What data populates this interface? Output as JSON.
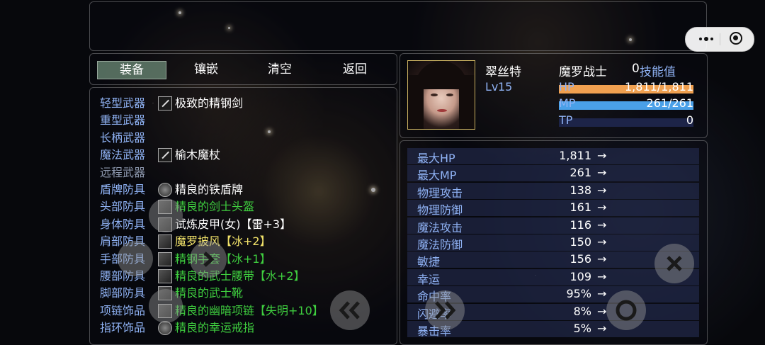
{
  "commands": [
    {
      "label": "装备",
      "active": true
    },
    {
      "label": "镶嵌",
      "active": false
    },
    {
      "label": "清空",
      "active": false
    },
    {
      "label": "返回",
      "active": false
    }
  ],
  "equipment": [
    {
      "slot": "轻型武器",
      "item": "极致的精钢剑",
      "icon": "sword-icon",
      "item_color": "#ffffff"
    },
    {
      "slot": "重型武器",
      "item": "",
      "icon": "",
      "item_color": "#ffffff"
    },
    {
      "slot": "长柄武器",
      "item": "",
      "icon": "",
      "item_color": "#ffffff"
    },
    {
      "slot": "魔法武器",
      "item": "榆木魔杖",
      "icon": "staff-icon",
      "item_color": "#ffffff"
    },
    {
      "slot": "远程武器",
      "item": "",
      "icon": "",
      "item_color": "#ffffff",
      "disabled": true
    },
    {
      "slot": "盾牌防具",
      "item": "精良的铁盾牌",
      "icon": "shield-icon",
      "item_color": "#ffffff"
    },
    {
      "slot": "头部防具",
      "item": "精良的剑士头盔",
      "icon": "helmet-icon",
      "item_color": "#3fcf3f"
    },
    {
      "slot": "身体防具",
      "item": "试炼皮甲(女)【雷+3】",
      "icon": "armor-icon",
      "item_color": "#ffffff"
    },
    {
      "slot": "肩部防具",
      "item": "魔罗披风【冰+2】",
      "icon": "cloak-icon",
      "item_color": "#f2e36a"
    },
    {
      "slot": "手部防具",
      "item": "精钢手套【冰+1】",
      "icon": "gloves-icon",
      "item_color": "#3fcf3f"
    },
    {
      "slot": "腰部防具",
      "item": "精良的武士腰带【水+2】",
      "icon": "belt-icon",
      "item_color": "#3fcf3f"
    },
    {
      "slot": "脚部防具",
      "item": "精良的武士靴",
      "icon": "boots-icon",
      "item_color": "#3fcf3f"
    },
    {
      "slot": "项链饰品",
      "item": "精良的幽暗项链【失明+10】",
      "icon": "necklace-icon",
      "item_color": "#3fcf3f"
    },
    {
      "slot": "指环饰品",
      "item": "精良的幸运戒指",
      "icon": "ring-icon",
      "item_color": "#3fcf3f"
    }
  ],
  "character": {
    "name": "翠丝特",
    "class": "魔罗战士",
    "skill_points": "0",
    "skill_label": "技能值",
    "level_label": "Lv",
    "level": "15",
    "hp_label": "HP",
    "hp": "1,811/1,811",
    "hp_fraction": 1.0,
    "mp_label": "MP",
    "mp": "261/261",
    "mp_fraction": 1.0,
    "tp_label": "TP",
    "tp": "0",
    "tp_fraction": 0.0,
    "hp_color": "#f0a050",
    "mp_color": "#4aa0e8"
  },
  "stats": [
    {
      "label": "最大HP",
      "value": "1,811"
    },
    {
      "label": "最大MP",
      "value": "261"
    },
    {
      "label": "物理攻击",
      "value": "138"
    },
    {
      "label": "物理防御",
      "value": "161"
    },
    {
      "label": "魔法攻击",
      "value": "116"
    },
    {
      "label": "魔法防御",
      "value": "150"
    },
    {
      "label": "敏捷",
      "value": "156"
    },
    {
      "label": "幸运",
      "value": "109"
    },
    {
      "label": "命中率",
      "value": "95%"
    },
    {
      "label": "闪避率",
      "value": "8%"
    },
    {
      "label": "暴击率",
      "value": "5%"
    }
  ],
  "arrow": "→",
  "colors": {
    "label_blue": "#8fb2f4",
    "accent_green": "#3fcf3f",
    "accent_yellow": "#f2e36a"
  }
}
